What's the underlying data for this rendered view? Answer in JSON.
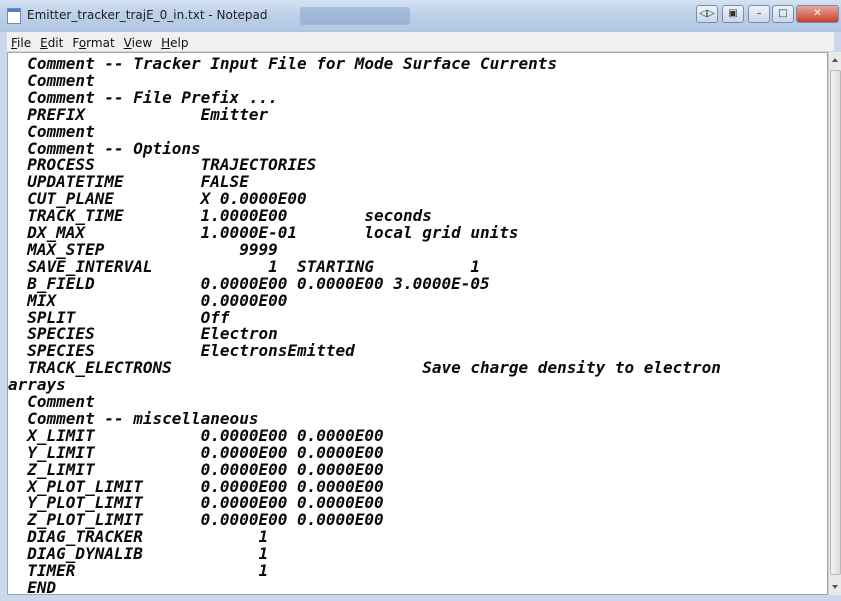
{
  "window": {
    "title": "Emitter_tracker_trajE_0_in.txt - Notepad"
  },
  "titlebar_buttons": {
    "b1": "◁▷",
    "b2": "▣",
    "minimize": "–",
    "maximize": "□",
    "close": "✕"
  },
  "menu": [
    {
      "ul": "F",
      "rest": "ile"
    },
    {
      "ul": "E",
      "rest": "dit"
    },
    {
      "pre": "F",
      "ul": "o",
      "rest": "rmat"
    },
    {
      "ul": "V",
      "rest": "iew"
    },
    {
      "ul": "H",
      "rest": "elp"
    }
  ],
  "lines": [
    "  Comment -- Tracker Input File for Mode Surface Currents",
    "  Comment",
    "  Comment -- File Prefix ...",
    "  PREFIX            Emitter",
    "  Comment",
    "  Comment -- Options",
    "  PROCESS           TRAJECTORIES",
    "  UPDATETIME        FALSE",
    "  CUT_PLANE         X 0.0000E00",
    "  TRACK_TIME        1.0000E00        seconds",
    "  DX_MAX            1.0000E-01       local grid units",
    "  MAX_STEP              9999",
    "  SAVE_INTERVAL            1  STARTING          1",
    "  B_FIELD           0.0000E00 0.0000E00 3.0000E-05",
    "  MIX               0.0000E00",
    "  SPLIT             Off",
    "  SPECIES           Electron",
    "  SPECIES           ElectronsEmitted",
    "  TRACK_ELECTRONS                          Save charge density to electron",
    "arrays",
    "  Comment",
    "  Comment -- miscellaneous",
    "  X_LIMIT           0.0000E00 0.0000E00",
    "  Y_LIMIT           0.0000E00 0.0000E00",
    "  Z_LIMIT           0.0000E00 0.0000E00",
    "  X_PLOT_LIMIT      0.0000E00 0.0000E00",
    "  Y_PLOT_LIMIT      0.0000E00 0.0000E00",
    "  Z_PLOT_LIMIT      0.0000E00 0.0000E00",
    "  DIAG_TRACKER            1",
    "  DIAG_DYNALIB            1",
    "  TIMER                   1",
    "  END"
  ]
}
